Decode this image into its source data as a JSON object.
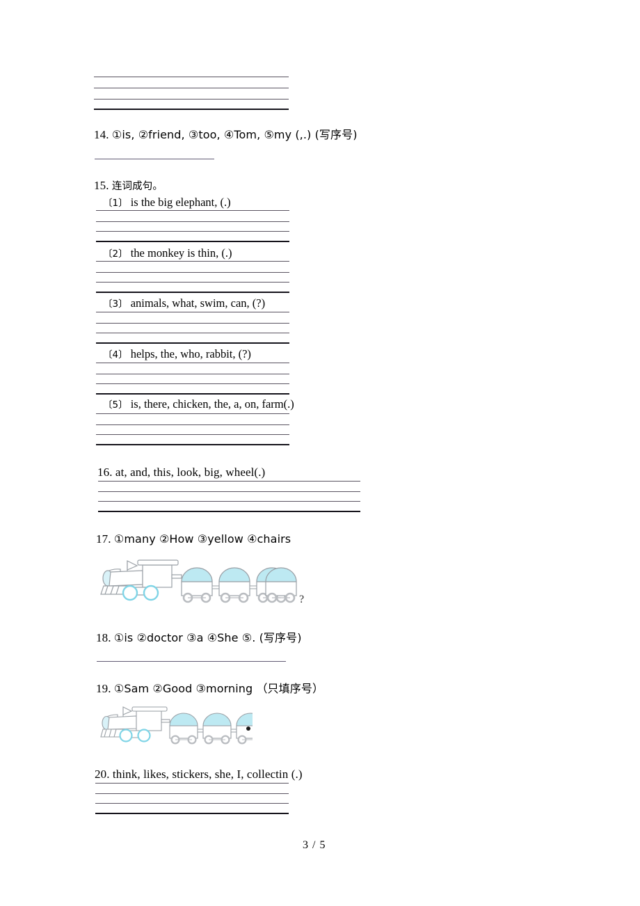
{
  "page": {
    "footer": "3 / 5",
    "number": "3",
    "total": "5"
  },
  "colors": {
    "text": "#000000",
    "rule": "#4b4453",
    "rule_thick": "#14121a",
    "train_dome": "#bde9f2",
    "train_outline": "#9aa0a6",
    "train_wheel": "#b9bcc0"
  },
  "questions": [
    {
      "id": "q14",
      "number": "14.",
      "text": "①is, ②friend, ③too, ④Tom, ⑤my (,.) (写序号)",
      "answer_kind": "single-rule"
    },
    {
      "id": "q15",
      "number": "15.",
      "text": "连词成句。",
      "answer_kind": "sub-items",
      "items": [
        {
          "marker": "〔1〕",
          "text": "is the big elephant, (.)"
        },
        {
          "marker": "〔2〕",
          "text": "the monkey is thin, (.)"
        },
        {
          "marker": "〔3〕",
          "text": "animals, what, swim, can, (?)"
        },
        {
          "marker": "〔4〕",
          "text": "helps, the, who, rabbit, (?)"
        },
        {
          "marker": "〔5〕",
          "text": "is, there, chicken, the, a, on, farm(.)"
        }
      ]
    },
    {
      "id": "q16",
      "number": "16.",
      "text": "at, and, this,  look,  big,  wheel(.)",
      "answer_kind": "lineblock-wide"
    },
    {
      "id": "q17",
      "number": "17.",
      "text": "①many  ②How  ③yellow  ④chairs",
      "answer_kind": "train",
      "train_cars": 4,
      "end_mark": "?"
    },
    {
      "id": "q18",
      "number": "18.",
      "text": "①is  ②doctor  ③a  ④She  ⑤. (写序号)",
      "answer_kind": "single-rule"
    },
    {
      "id": "q19",
      "number": "19.",
      "text": "①Sam   ②Good ③morning  （只填序号）",
      "answer_kind": "train",
      "train_cars": 3,
      "end_mark": "."
    },
    {
      "id": "q20",
      "number": "20.",
      "text": "think, likes, stickers, she, I, collectin (.)",
      "answer_kind": "lineblock"
    }
  ],
  "top_block": {
    "note": "continuation writing lines from previous question"
  }
}
